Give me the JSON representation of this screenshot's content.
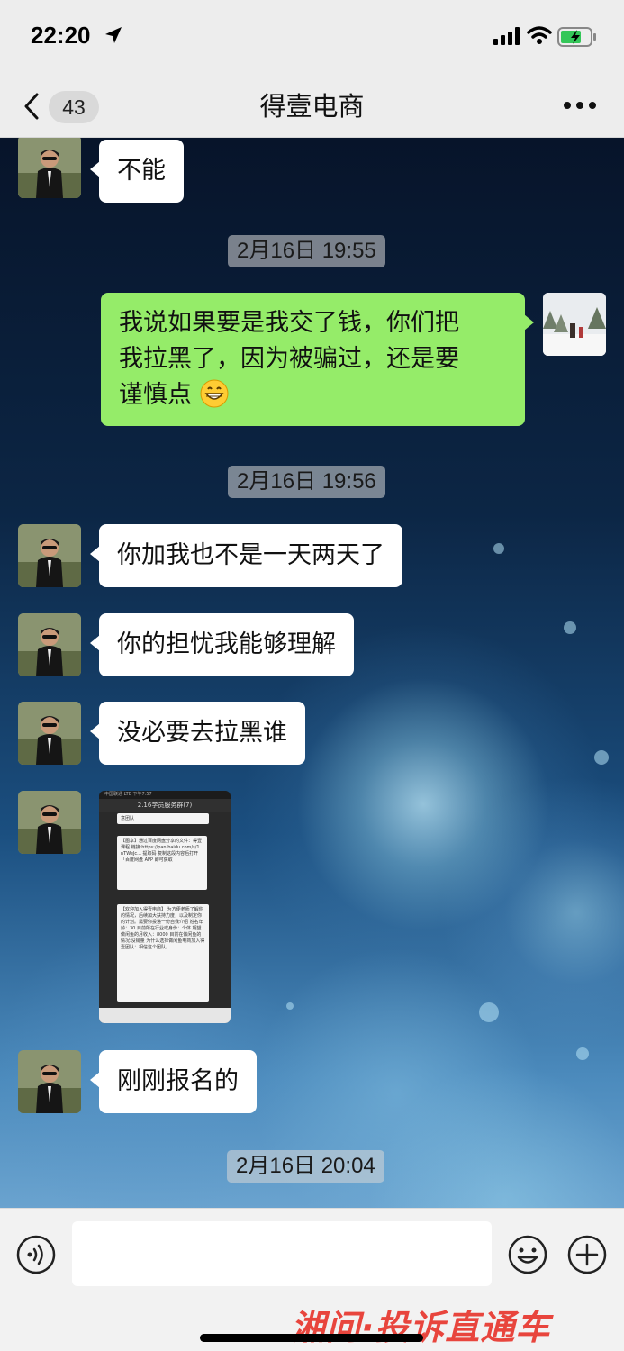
{
  "status_bar": {
    "time": "22:20"
  },
  "nav": {
    "unread_count": "43",
    "title": "得壹电商"
  },
  "messages": [
    {
      "type": "text",
      "side": "left",
      "text": "不能"
    },
    {
      "type": "timestamp",
      "text": "2月16日 19:55"
    },
    {
      "type": "text",
      "side": "right",
      "lines": [
        "我说如果要是我交了钱，你们把",
        "我拉黑了，因为被骗过，还是要",
        "谨慎点"
      ]
    },
    {
      "type": "timestamp",
      "text": "2月16日 19:56"
    },
    {
      "type": "text",
      "side": "left",
      "text": "你加我也不是一天两天了"
    },
    {
      "type": "text",
      "side": "left",
      "text": "你的担忧我能够理解"
    },
    {
      "type": "text",
      "side": "left",
      "text": "没必要去拉黑谁"
    },
    {
      "type": "image",
      "side": "left",
      "screenshot": {
        "status": "中国联通  LTE        下午7:57",
        "title": "2.16学员服务群(7)",
        "card1_top": "意团队",
        "card2": "【图享】通过百度网盘分享的文件：得壹课程 链接:https://pan.baidu.com/s/1 nTWeJc...  提取码 复制这段内容后打开「百度网盘 APP 即可获取",
        "card3": "【欢迎加入得壹电商】 为方便老师了解你的情况，后续加大扶持力度，以及制定你的计划。需要你投递一份自我介绍 姓名年龄：30 目前所在行业或身份：个体 期望做闲鱼的月收入：8000 目前在做闲鱼的情况:没销量 为什么选择做闲鱼电商加入得壹团队：相信这个团队。"
      }
    },
    {
      "type": "text",
      "side": "left",
      "text": "刚刚报名的"
    },
    {
      "type": "timestamp",
      "text": "2月16日 20:04"
    }
  ],
  "input": {
    "placeholder": ""
  },
  "watermark": "湘问·投诉直通车",
  "colors": {
    "sent_bubble": "#95ec69",
    "received_bubble": "#ffffff",
    "bar_bg": "#ededed"
  }
}
